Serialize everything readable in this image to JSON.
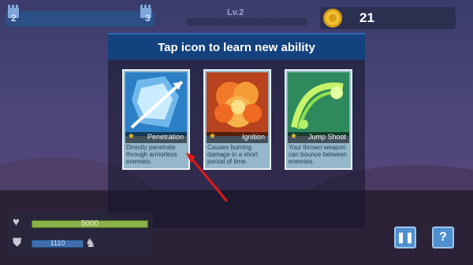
{
  "hud": {
    "wave_start": "2",
    "wave_end": "3",
    "level": "Lv.2",
    "coins": "21"
  },
  "modal": {
    "title": "Tap icon to learn new ability"
  },
  "abilities": [
    {
      "name": "Penetration",
      "description": "Directly penetrate through armorless enemies."
    },
    {
      "name": "Ignition",
      "description": "Causes burning damage in a short period of time."
    },
    {
      "name": "Jump Shoot",
      "description": "Your thrown weapon can bounce between enemies."
    }
  ],
  "player": {
    "hp": "5000",
    "shield": "1110"
  },
  "buttons": {
    "pause_glyph": "❚❚",
    "help_glyph": "?"
  },
  "icons": {
    "heart": "heart-icon",
    "shield": "shield-icon",
    "armor": "armor-icon",
    "coin": "coin-icon",
    "castle": "castle-icon"
  }
}
